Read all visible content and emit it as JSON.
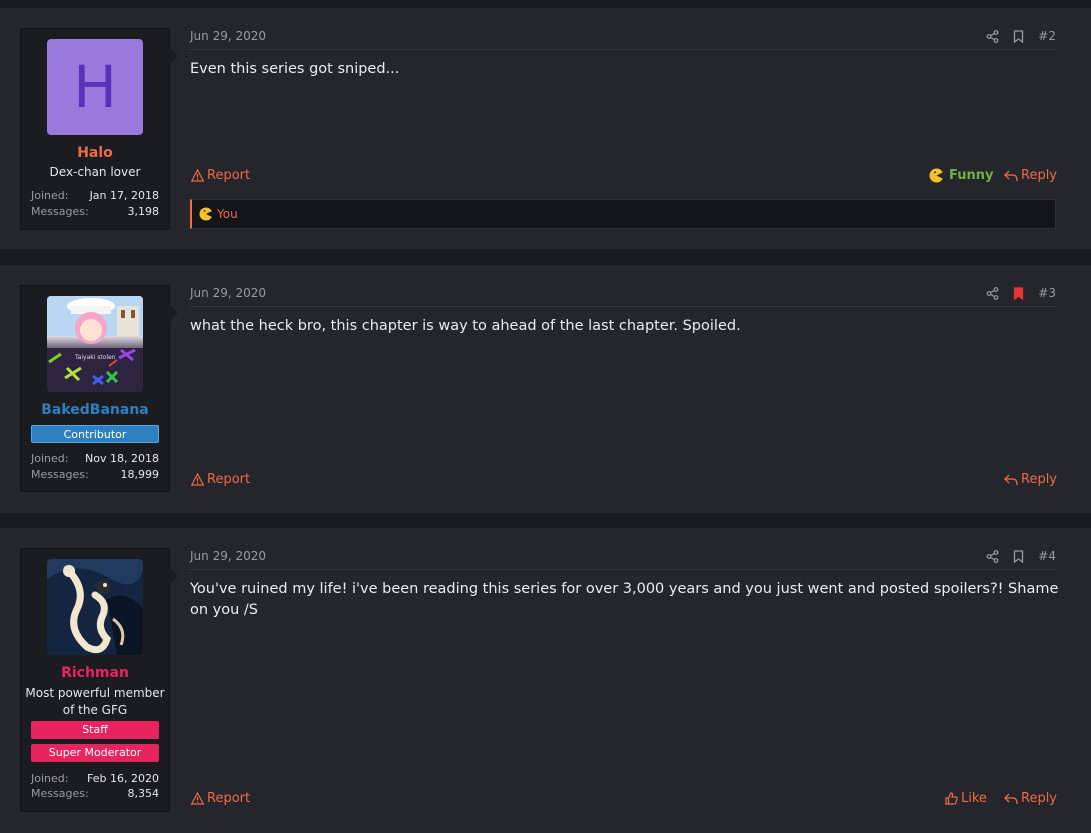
{
  "posts": [
    {
      "date": "Jun 29, 2020",
      "number": "#2",
      "message": "Even this series got sniped...",
      "user": {
        "avatar_letter": "H",
        "name": "Halo",
        "name_color": "#ef6a45",
        "title": "Dex-chan lover",
        "joined_label": "Joined:",
        "joined": "Jan 17, 2018",
        "messages_label": "Messages:",
        "messages": "3,198"
      },
      "report_label": "Report",
      "reaction_label": "Funny",
      "reply_label": "Reply",
      "reacted_by": "You"
    },
    {
      "date": "Jun 29, 2020",
      "number": "#3",
      "message": "what the heck bro, this chapter is way to ahead of the last chapter. Spoiled.",
      "user": {
        "name": "BakedBanana",
        "name_color": "#2d7fc1",
        "avatar_text": "Taiyaki stolen",
        "badge": "Contributor",
        "joined_label": "Joined:",
        "joined": "Nov 18, 2018",
        "messages_label": "Messages:",
        "messages": "18,999"
      },
      "report_label": "Report",
      "reply_label": "Reply"
    },
    {
      "date": "Jun 29, 2020",
      "number": "#4",
      "message": "You've ruined my life! i've been reading this series for over 3,000 years and you just went and posted spoilers?! Shame on you /S",
      "user": {
        "name": "Richman",
        "name_color": "#e8245f",
        "title": "Most powerful member of the GFG",
        "badges": [
          "Staff",
          "Super Moderator"
        ],
        "joined_label": "Joined:",
        "joined": "Feb 16, 2020",
        "messages_label": "Messages:",
        "messages": "8,354"
      },
      "report_label": "Report",
      "like_label": "Like",
      "reply_label": "Reply"
    }
  ],
  "colors": {
    "accent": "#ef6a45",
    "funny": "#6fb33f",
    "contributor": "#2d7fc1",
    "staff": "#e8245f",
    "bookmark_active": "#e63737"
  }
}
